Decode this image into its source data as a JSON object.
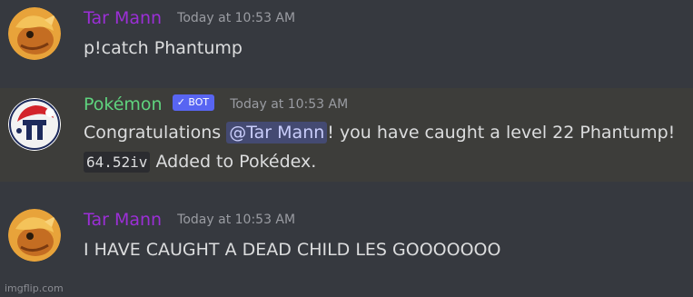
{
  "messages": [
    {
      "username": "Tar Mann",
      "timestamp": "Today at 10:53 AM",
      "text": "p!catch Phantump"
    },
    {
      "username": "Pokémon",
      "bot_tag": "✓ BOT",
      "timestamp": "Today at 10:53 AM",
      "text_before": "Congratulations ",
      "mention": "@Tar Mann",
      "text_after": "! you have caught a level 22 Phantump!",
      "iv_code": "64.52iv",
      "text_line2": " Added to Pokédex."
    },
    {
      "username": "Tar Mann",
      "timestamp": "Today at 10:53 AM",
      "text": "I HAVE CAUGHT A DEAD CHILD LES GOOOOOOO"
    }
  ],
  "watermark": "imgflip.com",
  "colors": {
    "background": "#36393f",
    "highlight_row": "#3d3d3a",
    "tar_mann_name": "#9b2fd6",
    "pokemon_name": "#5fd37e",
    "bot_tag": "#5865f2",
    "mention_bg": "#444a72"
  }
}
